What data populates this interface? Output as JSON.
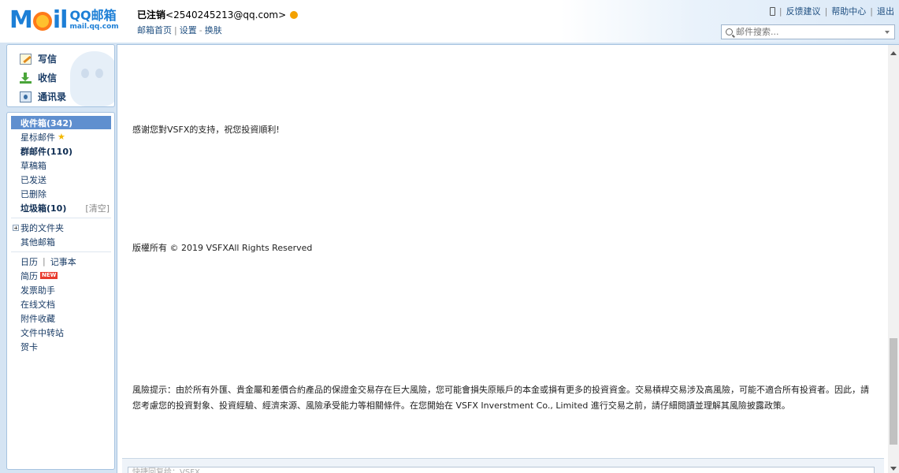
{
  "header": {
    "logo": {
      "mark": "M",
      "mark_end": "il",
      "brand": "QQ邮箱",
      "domain": "mail.qq.com"
    },
    "account": {
      "status": "已注销",
      "email": "<2540245213@qq.com>"
    },
    "account_links": [
      "邮箱首页",
      "设置",
      "换肤"
    ],
    "top_links": [
      "反馈建议",
      "帮助中心",
      "退出"
    ],
    "search": {
      "placeholder": "邮件搜索..."
    }
  },
  "sidebar": {
    "actions": {
      "write": "写信",
      "receive": "收信",
      "contacts": "通讯录"
    },
    "folders": {
      "inbox": "收件箱(342)",
      "starred": "星标邮件",
      "group": "群邮件(110)",
      "drafts": "草稿箱",
      "sent": "已发送",
      "deleted": "已删除",
      "spam": "垃圾箱(10)",
      "spam_clear": "[清空]",
      "my_folders": "我的文件夹",
      "other_mailbox": "其他邮箱"
    },
    "apps": {
      "calendar": "日历",
      "notes": "记事本",
      "resume": "简历",
      "resume_badge": "NEW",
      "invoice": "发票助手",
      "docs": "在线文档",
      "attachments": "附件收藏",
      "transfer": "文件中转站",
      "cards": "贺卡"
    }
  },
  "email": {
    "thanks": "感谢您對VSFX的支持，祝您投資順利!",
    "copyright": "版權所有 © 2019 VSFXAll Rights Reserved",
    "risk_line1": "風險提示：由於所有外匯、貴金屬和差價合約產品的保證金交易存在巨大風險，您可能會損失原賬戶的本金或損有更多的投資資金。交易槓桿交易涉及高風險，可能不適合所有投資者。因此，請",
    "risk_line2": "您考慮您的投資對象、投資經驗、經濟來源、風險承受能力等相關條件。在您開始在 VSFX Inverstment Co., Limited 進行交易之前，請仔細閱讀並理解其風險披露政策。"
  },
  "reply": {
    "placeholder": "快捷回复给：VSFX"
  }
}
